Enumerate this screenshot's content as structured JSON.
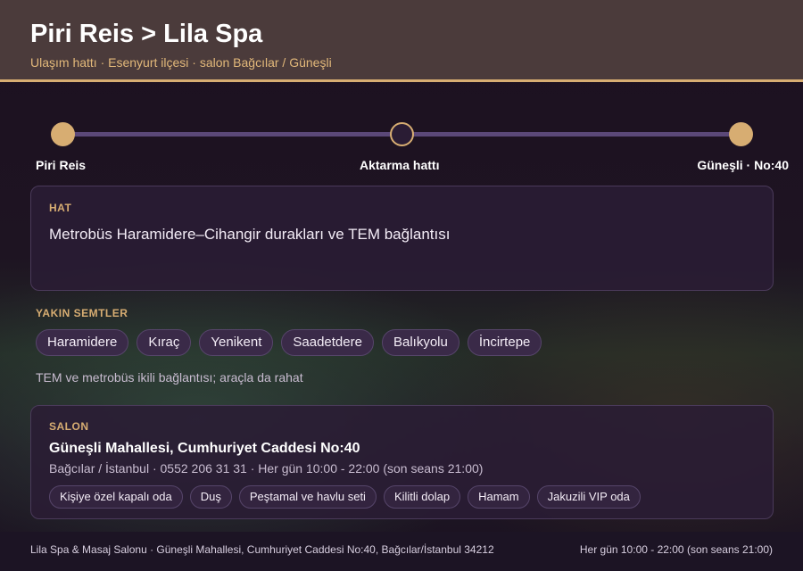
{
  "header": {
    "title": "Piri Reis > Lila Spa",
    "subtitle": "Ulaşım hattı · Esenyurt ilçesi · salon Bağcılar / Güneşli"
  },
  "route": {
    "start": "Piri Reis",
    "middle": "Aktarma hattı",
    "end": "Güneşli · No:40"
  },
  "line_card": {
    "tag": "HAT",
    "text": "Metrobüs Haramidere–Cihangir durakları ve TEM bağlantısı"
  },
  "nearby": {
    "label": "YAKIN SEMTLER",
    "items": [
      "Haramidere",
      "Kıraç",
      "Yenikent",
      "Saadetdere",
      "Balıkyolu",
      "İncirtepe"
    ],
    "note": "TEM ve metrobüs ikili bağlantısı; araçla da rahat"
  },
  "salon": {
    "tag": "SALON",
    "name": "Güneşli Mahallesi, Cumhuriyet Caddesi No:40",
    "meta": "Bağcılar / İstanbul · 0552 206 31 31 · Her gün 10:00 - 22:00 (son seans 21:00)",
    "amenities": [
      "Kişiye özel kapalı oda",
      "Duş",
      "Peştamal ve havlu seti",
      "Kilitli dolap",
      "Hamam",
      "Jakuzili VIP oda"
    ]
  },
  "footer": {
    "left": "Lila Spa & Masaj Salonu · Güneşli Mahallesi, Cumhuriyet Caddesi No:40, Bağcılar/İstanbul 34212",
    "right": "Her gün 10:00 - 22:00 (son seans 21:00)"
  }
}
